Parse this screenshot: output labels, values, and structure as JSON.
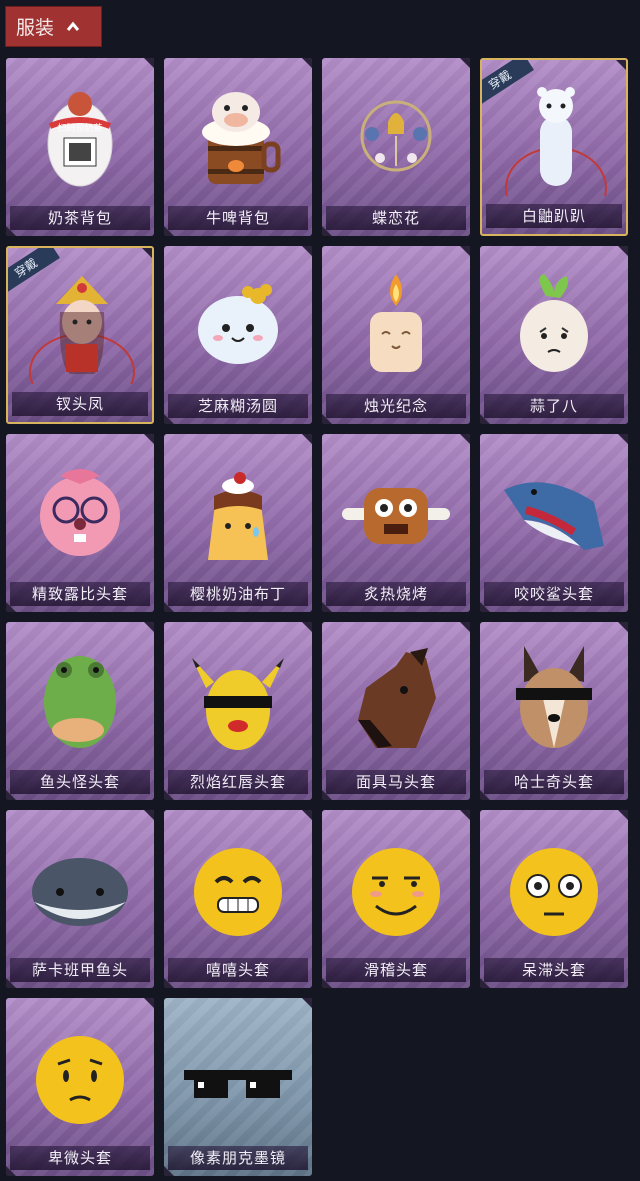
{
  "section": {
    "label": "服装",
    "expanded_icon": "chevron-up-icon"
  },
  "equipped_badge": "穿戴",
  "items": [
    {
      "name": "奶茶背包",
      "equipped": false,
      "theme": "purple"
    },
    {
      "name": "牛啤背包",
      "equipped": false,
      "theme": "purple"
    },
    {
      "name": "蝶恋花",
      "equipped": false,
      "theme": "purple"
    },
    {
      "name": "白鼬趴趴",
      "equipped": true,
      "theme": "purple"
    },
    {
      "name": "钗头凤",
      "equipped": true,
      "theme": "purple"
    },
    {
      "name": "芝麻糊汤圆",
      "equipped": false,
      "theme": "purple"
    },
    {
      "name": "烛光纪念",
      "equipped": false,
      "theme": "purple"
    },
    {
      "name": "蒜了八",
      "equipped": false,
      "theme": "purple"
    },
    {
      "name": "精致露比头套",
      "equipped": false,
      "theme": "purple"
    },
    {
      "name": "樱桃奶油布丁",
      "equipped": false,
      "theme": "purple"
    },
    {
      "name": "炙热烧烤",
      "equipped": false,
      "theme": "purple"
    },
    {
      "name": "咬咬鲨头套",
      "equipped": false,
      "theme": "purple"
    },
    {
      "name": "鱼头怪头套",
      "equipped": false,
      "theme": "purple"
    },
    {
      "name": "烈焰红唇头套",
      "equipped": false,
      "theme": "purple"
    },
    {
      "name": "面具马头套",
      "equipped": false,
      "theme": "purple"
    },
    {
      "name": "哈士奇头套",
      "equipped": false,
      "theme": "purple"
    },
    {
      "name": "萨卡班甲鱼头",
      "equipped": false,
      "theme": "purple"
    },
    {
      "name": "嘻嘻头套",
      "equipped": false,
      "theme": "purple"
    },
    {
      "name": "滑稽头套",
      "equipped": false,
      "theme": "purple"
    },
    {
      "name": "呆滞头套",
      "equipped": false,
      "theme": "purple"
    },
    {
      "name": "卑微头套",
      "equipped": false,
      "theme": "purple"
    },
    {
      "name": "像素朋克墨镜",
      "equipped": false,
      "theme": "blue"
    }
  ],
  "art_text": {
    "milk_tea_cup": "扫码领奶茶"
  },
  "colors": {
    "purple_card": "#9b77b3",
    "blue_card": "#8aa1b5",
    "equipped_border": "#d8b45f",
    "tab_red": "#a03232"
  }
}
